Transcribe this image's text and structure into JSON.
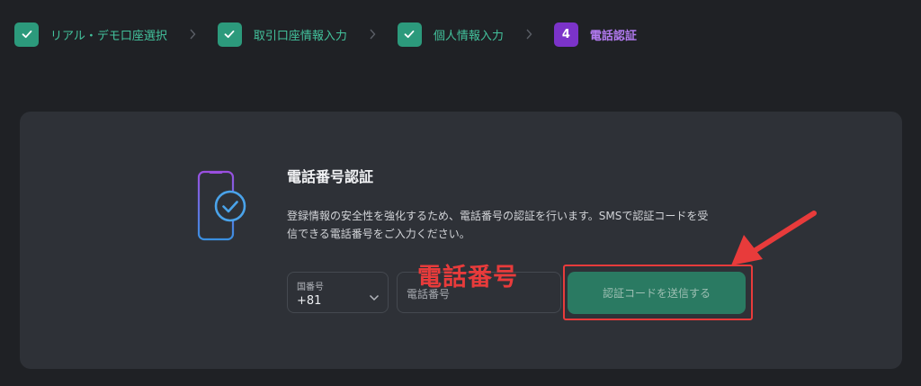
{
  "stepper": {
    "steps": [
      {
        "label": "リアル・デモ口座選択",
        "state": "done"
      },
      {
        "label": "取引口座情報入力",
        "state": "done"
      },
      {
        "label": "個人情報入力",
        "state": "done"
      },
      {
        "label": "電話認証",
        "state": "current",
        "number": "4"
      }
    ]
  },
  "card": {
    "title": "電話番号認証",
    "description_line1": "登録情報の安全性を強化するため、電話番号の認証を行います。SMSで認証コードを受",
    "description_line2": "信できる電話番号をご入力ください。"
  },
  "form": {
    "country_label": "国番号",
    "country_value": "+81",
    "phone_placeholder": "電話番号",
    "phone_value": "",
    "send_button_label": "認証コードを送信する"
  },
  "annotation": {
    "text": "電話番号",
    "color": "#e83b3b"
  },
  "colors": {
    "background": "#1f2125",
    "card": "#2e3137",
    "done_step": "#2c9a7c",
    "current_step": "#7b33c9",
    "button": "#2a7a62"
  }
}
